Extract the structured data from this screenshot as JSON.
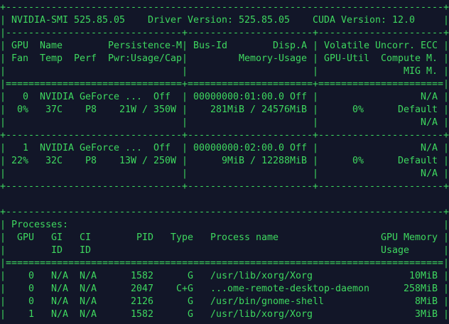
{
  "theme": {
    "background": "#121628",
    "text": "#3ed85f"
  },
  "terminal": {
    "lines": [
      "+-----------------------------------------------------------------------------+",
      "| NVIDIA-SMI 525.85.05    Driver Version: 525.85.05    CUDA Version: 12.0     |",
      "|-------------------------------+----------------------+----------------------+",
      "| GPU  Name        Persistence-M| Bus-Id        Disp.A | Volatile Uncorr. ECC |",
      "| Fan  Temp  Perf  Pwr:Usage/Cap|         Memory-Usage | GPU-Util  Compute M. |",
      "|                               |                      |               MIG M. |",
      "|===============================+======================+======================|",
      "|   0  NVIDIA GeForce ...  Off  | 00000000:01:00.0 Off |                  N/A |",
      "|  0%   37C    P8    21W / 350W |    281MiB / 24576MiB |      0%      Default |",
      "|                               |                      |                  N/A |",
      "+-------------------------------+----------------------+----------------------+",
      "|   1  NVIDIA GeForce ...  Off  | 00000000:02:00.0 Off |                  N/A |",
      "| 22%   32C    P8    13W / 250W |      9MiB / 12288MiB |      0%      Default |",
      "|                               |                      |                  N/A |",
      "+-------------------------------+----------------------+----------------------+",
      "",
      "+-----------------------------------------------------------------------------+",
      "| Processes:                                                                  |",
      "|  GPU   GI   CI        PID   Type   Process name                  GPU Memory |",
      "|        ID   ID                                                   Usage      |",
      "|=============================================================================|",
      "|    0   N/A  N/A      1582      G   /usr/lib/xorg/Xorg                 10MiB |",
      "|    0   N/A  N/A      2047    C+G   ...ome-remote-desktop-daemon      258MiB |",
      "|    0   N/A  N/A      2126      G   /usr/bin/gnome-shell                8MiB |",
      "|    1   N/A  N/A      1582      G   /usr/lib/xorg/Xorg                  3MiB |",
      "+-----------------------------------------------------------------------------+"
    ]
  }
}
